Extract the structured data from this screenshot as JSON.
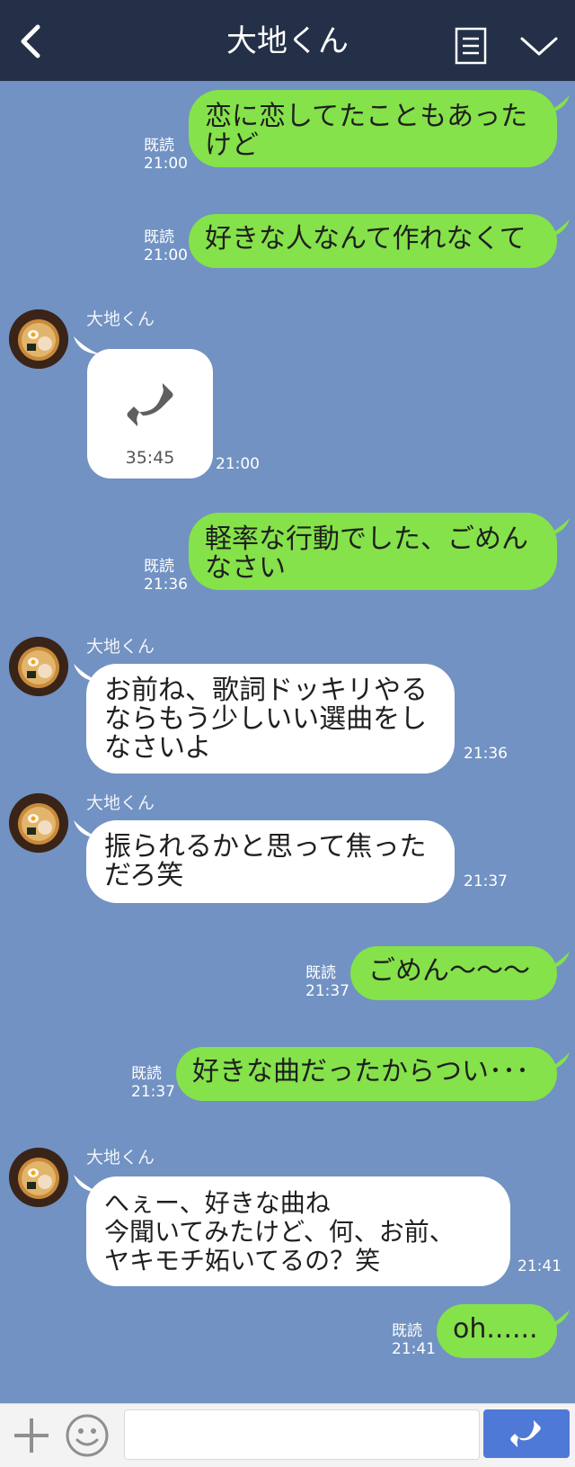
{
  "header": {
    "title": "大地くん",
    "icons": [
      "back-icon",
      "notes-icon",
      "chevron-down-icon"
    ]
  },
  "messages": [
    {
      "from": "me",
      "text_lines": [
        "恋に恋してたこともあった",
        "けど"
      ],
      "read": "既読",
      "time": "21:00"
    },
    {
      "from": "me",
      "text_lines": [
        "好きな人なんて作れなくて"
      ],
      "read": "既読",
      "time": "21:00"
    },
    {
      "from": "them",
      "sender": "大地くん",
      "type": "call",
      "duration": "35:45",
      "time": "21:00"
    },
    {
      "from": "me",
      "text_lines": [
        "軽率な行動でした、ごめん",
        "なさい"
      ],
      "read": "既読",
      "time": "21:36"
    },
    {
      "from": "them",
      "sender": "大地くん",
      "text_lines": [
        "お前ね、歌詞ドッキリやる",
        "ならもう少しいい選曲をし",
        "なさいよ"
      ],
      "time": "21:36"
    },
    {
      "from": "them",
      "sender": "大地くん",
      "text_lines": [
        "振られるかと思って焦った",
        "だろ笑"
      ],
      "time": "21:37"
    },
    {
      "from": "me",
      "text_lines": [
        "ごめん〜〜〜"
      ],
      "read": "既読",
      "time": "21:37"
    },
    {
      "from": "me",
      "text_lines": [
        "好きな曲だったからつい･･･"
      ],
      "read": "既読",
      "time": "21:37"
    },
    {
      "from": "them",
      "sender": "大地くん",
      "text_lines": [
        "へぇー、好きな曲ね",
        "今聞いてみたけど、何、お前、",
        "ヤキモチ妬いてるの？笑"
      ],
      "time": "21:41"
    },
    {
      "from": "me",
      "text_lines": [
        "oh......"
      ],
      "read": "既読",
      "time": "21:41"
    }
  ],
  "input": {
    "placeholder": ""
  },
  "colors": {
    "header": "#243048",
    "background": "#7192c2",
    "my_bubble": "#85e24a",
    "their_bubble": "#ffffff",
    "call_button": "#4f79d6"
  }
}
